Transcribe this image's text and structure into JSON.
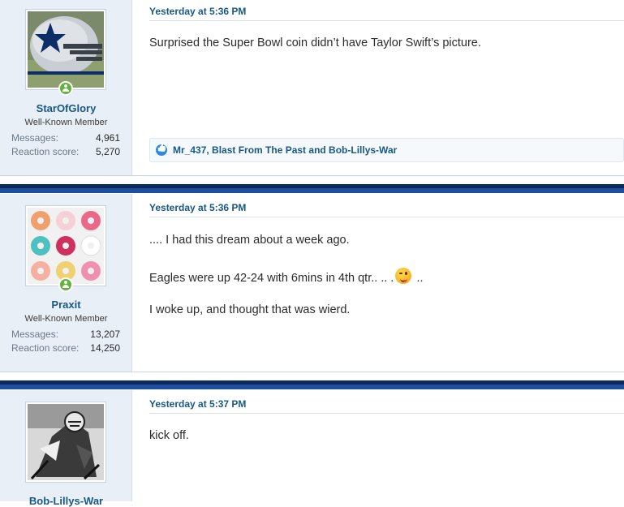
{
  "posts": [
    {
      "username": "StarOfGlory",
      "user_title": "Well-Known Member",
      "avatar_icon": "helmet-star-avatar",
      "stats": [
        {
          "label": "Messages:",
          "value": "4,961"
        },
        {
          "label": "Reaction score:",
          "value": "5,270"
        }
      ],
      "date": "Yesterday at 5:36 PM",
      "lines": [
        "Surprised the Super Bowl coin didn’t have Taylor Swift’s picture."
      ],
      "reactions": "Mr_437, Blast From The Past and Bob-Lillys-War"
    },
    {
      "username": "Praxit",
      "user_title": "Well-Known Member",
      "avatar_icon": "donuts-avatar",
      "stats": [
        {
          "label": "Messages:",
          "value": "13,207"
        },
        {
          "label": "Reaction score:",
          "value": "14,250"
        }
      ],
      "date": "Yesterday at 5:36 PM",
      "lines": [
        ".... I had this dream about a week ago.",
        "Eagles were up 42-24 with 6mins in 4th qtr.. .. .",
        "..",
        "I woke up, and thought that was wierd."
      ],
      "emoji": "wink-tongue-emoji"
    },
    {
      "username": "Bob-Lillys-War",
      "avatar_icon": "football-player-avatar",
      "date": "Yesterday at 5:37 PM",
      "lines": [
        "kick off."
      ]
    }
  ],
  "colors": {
    "sidebar_bg": "#e9eff7",
    "link": "#185886",
    "separator_dark": "#0b2a5b",
    "separator_mid": "#1e4f9c",
    "online": "#63b23b"
  }
}
